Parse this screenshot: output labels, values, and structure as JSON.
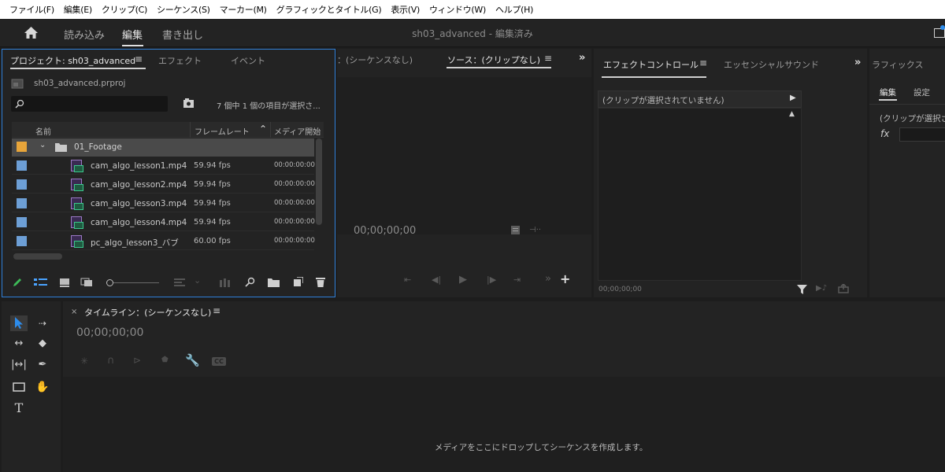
{
  "menu": [
    "ファイル(F)",
    "編集(E)",
    "クリップ(C)",
    "シーケンス(S)",
    "マーカー(M)",
    "グラフィックとタイトル(G)",
    "表示(V)",
    "ウィンドウ(W)",
    "ヘルプ(H)"
  ],
  "workspace": {
    "tabs": [
      "読み込み",
      "編集",
      "書き出し"
    ],
    "active": "編集",
    "project_title": "sh03_advanced - 編集済み"
  },
  "project_panel": {
    "tab": "プロジェクト: sh03_advanced",
    "tabs_other": [
      "エフェクト",
      "イベント"
    ],
    "file": "sh03_advanced.prproj",
    "search_placeholder": "",
    "selection_info": "7 個中 1 個の項目が選択さ...",
    "columns": [
      "名前",
      "フレームレート",
      "メディア開始"
    ],
    "folder": {
      "name": "01_Footage",
      "color": "#e8a53a"
    },
    "items": [
      {
        "name": "cam_algo_lesson1.mp4",
        "fps": "59.94 fps",
        "start": "00:00:00:00"
      },
      {
        "name": "cam_algo_lesson2.mp4",
        "fps": "59.94 fps",
        "start": "00:00:00:00"
      },
      {
        "name": "cam_algo_lesson3.mp4",
        "fps": "59.94 fps",
        "start": "00:00:00:00"
      },
      {
        "name": "cam_algo_lesson4.mp4",
        "fps": "59.94 fps",
        "start": "00:00:00:00"
      },
      {
        "name": "pc_algo_lesson3_バブ",
        "fps": "60.00 fps",
        "start": "00:00:00:00"
      }
    ]
  },
  "source_panel": {
    "tab_prev": "：(シーケンスなし)",
    "tab": "ソース：(クリップなし)",
    "timecode": "00;00;00;00"
  },
  "effect_controls": {
    "tab": "エフェクトコントロール",
    "tab2": "エッセンシャルサウンド",
    "no_clip": "(クリップが選択されていません)",
    "timecode": "00;00;00;00"
  },
  "graphics_panel": {
    "tab": "ラフィックス",
    "subtabs": [
      "編集",
      "設定"
    ],
    "no_clip": "(クリップが選択さ",
    "fx": "fx"
  },
  "timeline": {
    "tab": "タイムライン：(シーケンスなし)",
    "close": "×",
    "timecode": "00;00;00;00",
    "drop_hint": "メディアをここにドロップしてシーケンスを作成します。"
  }
}
